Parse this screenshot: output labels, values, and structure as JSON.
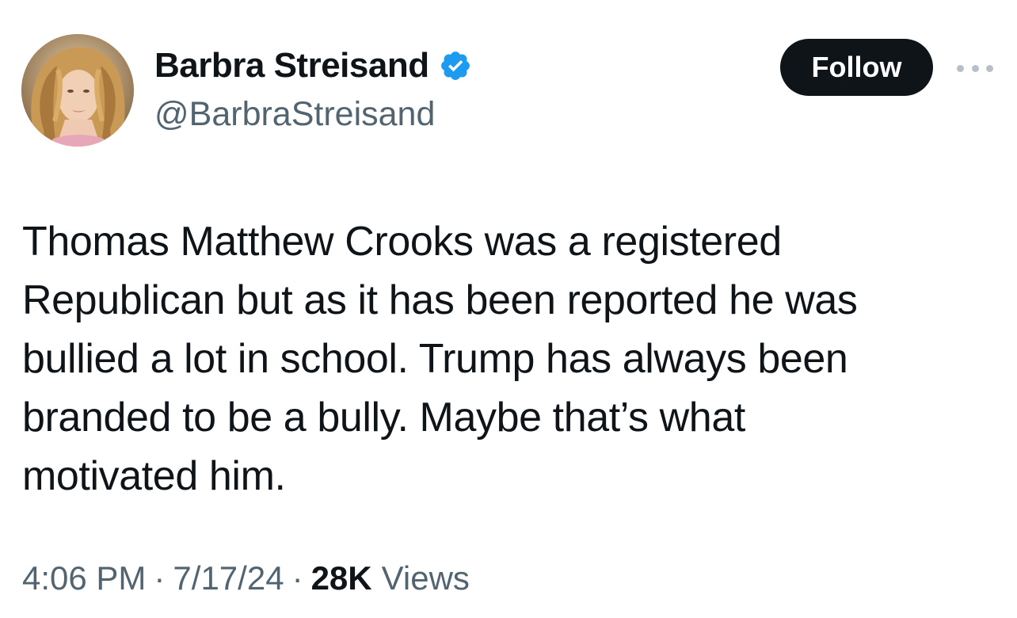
{
  "author": {
    "display_name": "Barbra Streisand",
    "handle": "@BarbraStreisand",
    "verified": true
  },
  "follow_label": "Follow",
  "more_icon": "more-horizontal-icon",
  "tweet": {
    "text": "Thomas Matthew Crooks was a registered\nRepublican but as it has been reported he was\nbullied a lot in school. Trump has always been\nbranded to be a bully. Maybe that’s what\nmotivated him.",
    "time": "4:06 PM",
    "date": "7/17/24",
    "separator": "·",
    "views_count": "28K",
    "views_label": "Views"
  },
  "colors": {
    "text_primary": "#0f1419",
    "text_secondary": "#536471",
    "verified_blue": "#1d9bf0",
    "follow_bg": "#0f1419",
    "follow_text": "#ffffff"
  }
}
